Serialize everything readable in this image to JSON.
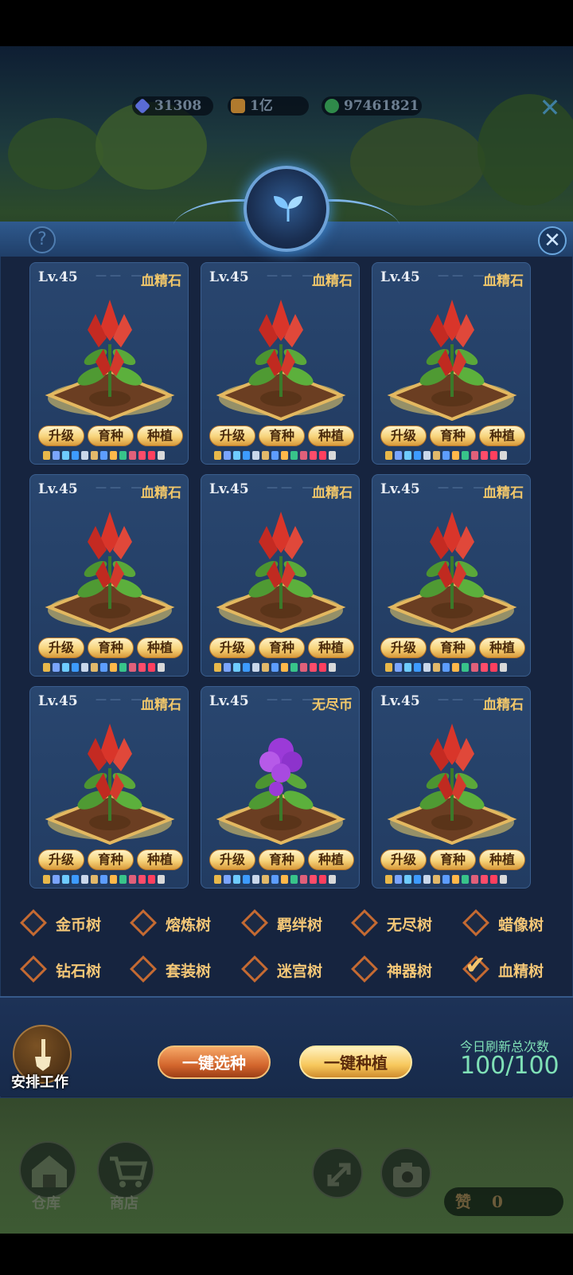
{
  "resources": [
    {
      "name": "diamond-icon",
      "value": "31308",
      "color": "#5a6bd6"
    },
    {
      "name": "gold-icon",
      "value": "1亿",
      "color": "#b07a2e"
    },
    {
      "name": "jade-icon",
      "value": "97461821",
      "color": "#2f8a4a"
    }
  ],
  "plots": [
    {
      "level": "Lv.45",
      "type": "血精石",
      "plant": "red"
    },
    {
      "level": "Lv.45",
      "type": "血精石",
      "plant": "red"
    },
    {
      "level": "Lv.45",
      "type": "血精石",
      "plant": "red"
    },
    {
      "level": "Lv.45",
      "type": "血精石",
      "plant": "red"
    },
    {
      "level": "Lv.45",
      "type": "血精石",
      "plant": "red"
    },
    {
      "level": "Lv.45",
      "type": "血精石",
      "plant": "red"
    },
    {
      "level": "Lv.45",
      "type": "血精石",
      "plant": "red"
    },
    {
      "level": "Lv.45",
      "type": "无尽币",
      "plant": "purple"
    },
    {
      "level": "Lv.45",
      "type": "血精石",
      "plant": "red"
    }
  ],
  "plot_buttons": {
    "upgrade": "升级",
    "breed": "育种",
    "plant": "种植"
  },
  "trees": [
    {
      "label": "金币树",
      "checked": false
    },
    {
      "label": "熔炼树",
      "checked": false
    },
    {
      "label": "羁绊树",
      "checked": false
    },
    {
      "label": "无尽树",
      "checked": false
    },
    {
      "label": "蜡像树",
      "checked": false
    },
    {
      "label": "钻石树",
      "checked": false
    },
    {
      "label": "套装树",
      "checked": false
    },
    {
      "label": "迷宫树",
      "checked": false
    },
    {
      "label": "神器树",
      "checked": false
    },
    {
      "label": "血精树",
      "checked": true
    }
  ],
  "actions": {
    "arrange_work": "安排工作",
    "one_click_select": "一键选种",
    "one_click_plant": "一键种植",
    "refresh_label": "今日刷新总次数",
    "refresh_value": "100/100"
  },
  "hud": {
    "warehouse": "仓库",
    "shop": "商店",
    "like_label": "赞",
    "like_count": "0"
  },
  "colors": {
    "panel": "#16243f",
    "card": "#29466f",
    "gold_text": "#f1c76a",
    "refresh_green": "#7fe0b6"
  }
}
